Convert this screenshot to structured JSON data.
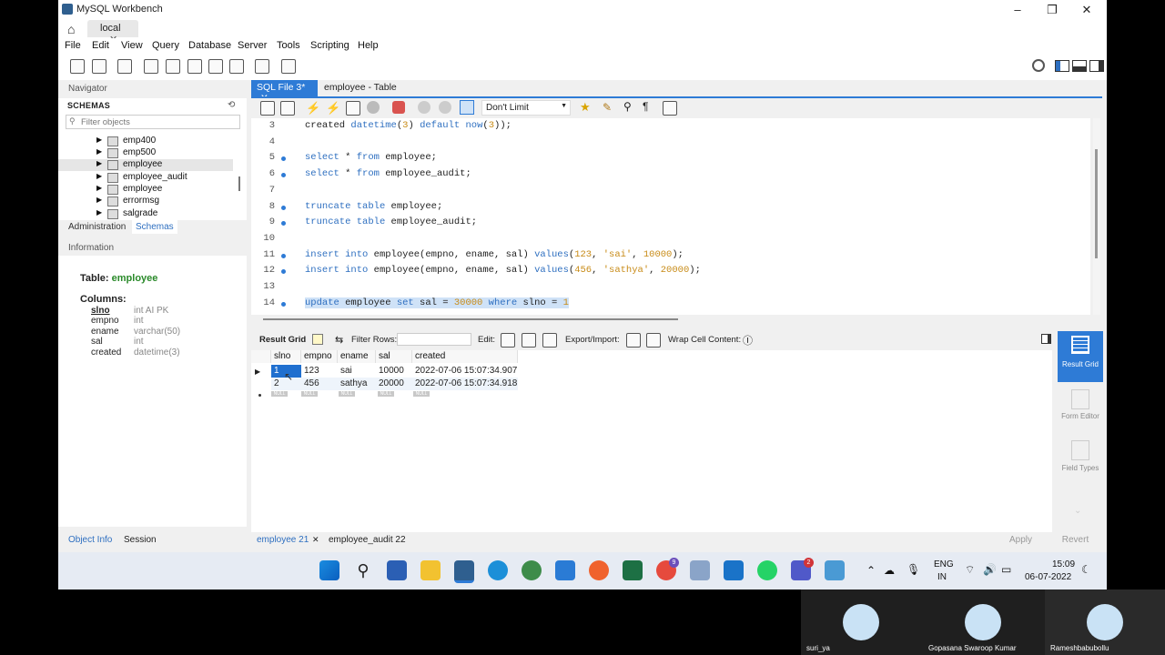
{
  "window": {
    "title": "MySQL Workbench",
    "tab": "local",
    "menu": [
      "File",
      "Edit",
      "View",
      "Query",
      "Database",
      "Server",
      "Tools",
      "Scripting",
      "Help"
    ]
  },
  "navigator": {
    "header": "Navigator",
    "schemas_label": "SCHEMAS",
    "filter_placeholder": "Filter objects",
    "items": [
      {
        "label": "emp400",
        "selected": false
      },
      {
        "label": "emp500",
        "selected": false
      },
      {
        "label": "employee",
        "selected": true
      },
      {
        "label": "employee_audit",
        "selected": false
      },
      {
        "label": "employee",
        "selected": false
      },
      {
        "label": "errormsg",
        "selected": false
      },
      {
        "label": "salgrade",
        "selected": false
      }
    ],
    "tabs": [
      "Administration",
      "Schemas"
    ]
  },
  "information": {
    "header": "Information",
    "table_label": "Table:",
    "table_name": "employee",
    "columns_label": "Columns:",
    "columns": [
      {
        "name": "slno",
        "type": "int AI PK"
      },
      {
        "name": "empno",
        "type": "int"
      },
      {
        "name": "ename",
        "type": "varchar(50)"
      },
      {
        "name": "sal",
        "type": "int"
      },
      {
        "name": "created",
        "type": "datetime(3)"
      }
    ],
    "tabs": [
      "Object Info",
      "Session"
    ]
  },
  "editor": {
    "tabs": [
      "SQL File 3*",
      "employee - Table"
    ],
    "limit_select": "Don't Limit",
    "lines": [
      {
        "n": "3",
        "dot": false,
        "parts": [
          [
            "",
            "created "
          ],
          [
            "kw",
            "datetime"
          ],
          [
            "",
            "("
          ],
          [
            "num",
            "3"
          ],
          [
            "",
            ") "
          ],
          [
            "kw",
            "default"
          ],
          [
            "",
            " "
          ],
          [
            "fn",
            "now"
          ],
          [
            "",
            "("
          ],
          [
            "num",
            "3"
          ],
          [
            "",
            "));"
          ]
        ]
      },
      {
        "n": "4",
        "dot": false,
        "parts": []
      },
      {
        "n": "5",
        "dot": true,
        "parts": [
          [
            "kw",
            "select"
          ],
          [
            "",
            " * "
          ],
          [
            "kw",
            "from"
          ],
          [
            "",
            " employee;"
          ]
        ]
      },
      {
        "n": "6",
        "dot": true,
        "parts": [
          [
            "kw",
            "select"
          ],
          [
            "",
            " * "
          ],
          [
            "kw",
            "from"
          ],
          [
            "",
            " employee_audit;"
          ]
        ]
      },
      {
        "n": "7",
        "dot": false,
        "parts": []
      },
      {
        "n": "8",
        "dot": true,
        "parts": [
          [
            "kw",
            "truncate"
          ],
          [
            "",
            " "
          ],
          [
            "kw",
            "table"
          ],
          [
            "",
            " employee;"
          ]
        ]
      },
      {
        "n": "9",
        "dot": true,
        "parts": [
          [
            "kw",
            "truncate"
          ],
          [
            "",
            " "
          ],
          [
            "kw",
            "table"
          ],
          [
            "",
            " employee_audit;"
          ]
        ]
      },
      {
        "n": "10",
        "dot": false,
        "parts": []
      },
      {
        "n": "11",
        "dot": true,
        "parts": [
          [
            "kw",
            "insert"
          ],
          [
            "",
            " "
          ],
          [
            "kw",
            "into"
          ],
          [
            "",
            " employee(empno, ename, sal) "
          ],
          [
            "kw",
            "values"
          ],
          [
            "",
            "("
          ],
          [
            "num",
            "123"
          ],
          [
            "",
            ", "
          ],
          [
            "str",
            "'sai'"
          ],
          [
            "",
            ", "
          ],
          [
            "num",
            "10000"
          ],
          [
            "",
            ");"
          ]
        ]
      },
      {
        "n": "12",
        "dot": true,
        "parts": [
          [
            "kw",
            "insert"
          ],
          [
            "",
            " "
          ],
          [
            "kw",
            "into"
          ],
          [
            "",
            " employee(empno, ename, sal) "
          ],
          [
            "kw",
            "values"
          ],
          [
            "",
            "("
          ],
          [
            "num",
            "456"
          ],
          [
            "",
            ", "
          ],
          [
            "str",
            "'sathya'"
          ],
          [
            "",
            ", "
          ],
          [
            "num",
            "20000"
          ],
          [
            "",
            ");"
          ]
        ]
      },
      {
        "n": "13",
        "dot": false,
        "parts": []
      },
      {
        "n": "14",
        "dot": true,
        "highlight": true,
        "parts": [
          [
            "kw",
            "update"
          ],
          [
            "",
            " employee "
          ],
          [
            "kw",
            "set"
          ],
          [
            "",
            " sal = "
          ],
          [
            "num",
            "30000"
          ],
          [
            "",
            " "
          ],
          [
            "kw",
            "where"
          ],
          [
            "",
            " slno = "
          ],
          [
            "num",
            "1"
          ]
        ]
      }
    ]
  },
  "result": {
    "toolbar": {
      "result_grid": "Result Grid",
      "filter_rows": "Filter Rows:",
      "edit": "Edit:",
      "export_import": "Export/Import:",
      "wrap": "Wrap Cell Content:"
    },
    "columns": [
      "slno",
      "empno",
      "ename",
      "sal",
      "created"
    ],
    "rows": [
      [
        "1",
        "123",
        "sai",
        "10000",
        "2022-07-06 15:07:34.907"
      ],
      [
        "2",
        "456",
        "sathya",
        "20000",
        "2022-07-06 15:07:34.918"
      ]
    ],
    "null_label": "NULL",
    "side_panel": [
      "Result Grid",
      "Form Editor",
      "Field Types"
    ],
    "bottom_tabs": [
      "employee 21",
      "employee_audit 22"
    ],
    "apply": "Apply",
    "revert": "Revert"
  },
  "taskbar": {
    "lang_1": "ENG",
    "lang_2": "IN",
    "time": "15:09",
    "date": "06-07-2022",
    "badge_chrome": "9",
    "badge_teams": "2"
  },
  "participants": [
    "suri_ya",
    "Gopasana Swaroop Kumar",
    "Rameshbabubollu"
  ],
  "colors": {
    "accent": "#2e7bd6",
    "selection": "#1f6fcf",
    "keyword": "#2e6fc0",
    "literal": "#c88b17"
  }
}
